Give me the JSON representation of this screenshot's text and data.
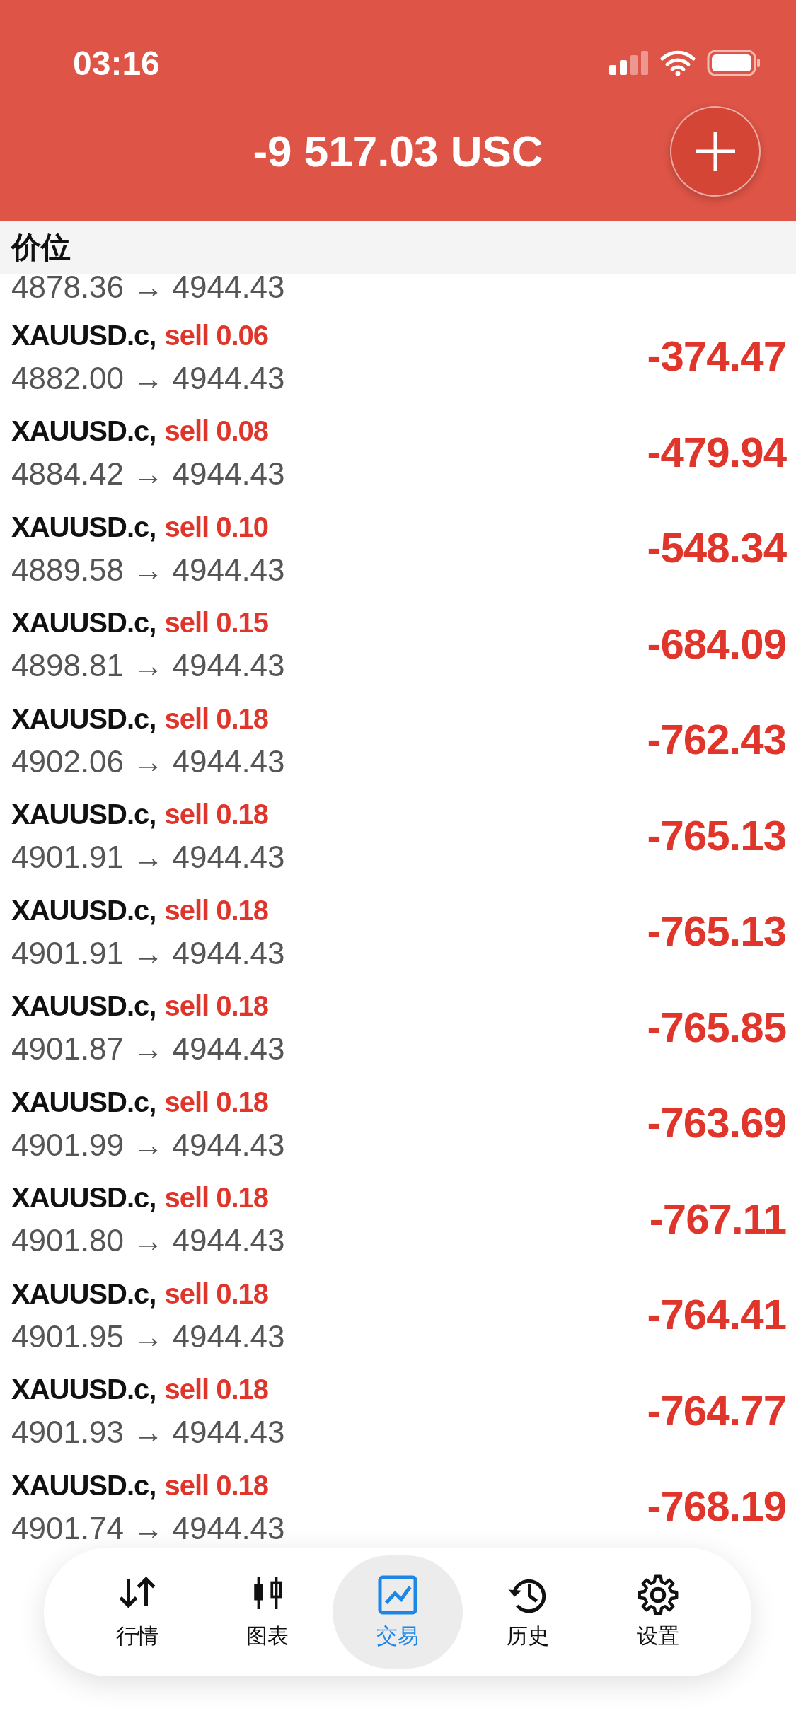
{
  "status_bar": {
    "time": "03:16"
  },
  "header": {
    "balance": "-9 517.03 USC"
  },
  "subheader": {
    "title": "价位"
  },
  "partial_row": {
    "prices": "4878.36 → 4944.43"
  },
  "positions": [
    {
      "symbol": "XAUUSD.c,",
      "side": "sell 0.06",
      "prices": "4882.00 → 4944.43",
      "profit": "-374.47"
    },
    {
      "symbol": "XAUUSD.c,",
      "side": "sell 0.08",
      "prices": "4884.42 → 4944.43",
      "profit": "-479.94"
    },
    {
      "symbol": "XAUUSD.c,",
      "side": "sell 0.10",
      "prices": "4889.58 → 4944.43",
      "profit": "-548.34"
    },
    {
      "symbol": "XAUUSD.c,",
      "side": "sell 0.15",
      "prices": "4898.81 → 4944.43",
      "profit": "-684.09"
    },
    {
      "symbol": "XAUUSD.c,",
      "side": "sell 0.18",
      "prices": "4902.06 → 4944.43",
      "profit": "-762.43"
    },
    {
      "symbol": "XAUUSD.c,",
      "side": "sell 0.18",
      "prices": "4901.91 → 4944.43",
      "profit": "-765.13"
    },
    {
      "symbol": "XAUUSD.c,",
      "side": "sell 0.18",
      "prices": "4901.91 → 4944.43",
      "profit": "-765.13"
    },
    {
      "symbol": "XAUUSD.c,",
      "side": "sell 0.18",
      "prices": "4901.87 → 4944.43",
      "profit": "-765.85"
    },
    {
      "symbol": "XAUUSD.c,",
      "side": "sell 0.18",
      "prices": "4901.99 → 4944.43",
      "profit": "-763.69"
    },
    {
      "symbol": "XAUUSD.c,",
      "side": "sell 0.18",
      "prices": "4901.80 → 4944.43",
      "profit": "-767.11"
    },
    {
      "symbol": "XAUUSD.c,",
      "side": "sell 0.18",
      "prices": "4901.95 → 4944.43",
      "profit": "-764.41"
    },
    {
      "symbol": "XAUUSD.c,",
      "side": "sell 0.18",
      "prices": "4901.93 → 4944.43",
      "profit": "-764.77"
    },
    {
      "symbol": "XAUUSD.c,",
      "side": "sell 0.18",
      "prices": "4901.74 → 4944.43",
      "profit": "-768.19"
    }
  ],
  "tab_bar": [
    {
      "kind": "quotes",
      "label": "行情",
      "selected": false
    },
    {
      "kind": "chart",
      "label": "图表",
      "selected": false
    },
    {
      "kind": "trade",
      "label": "交易",
      "selected": true
    },
    {
      "kind": "history",
      "label": "历史",
      "selected": false
    },
    {
      "kind": "settings",
      "label": "设置",
      "selected": false
    }
  ]
}
